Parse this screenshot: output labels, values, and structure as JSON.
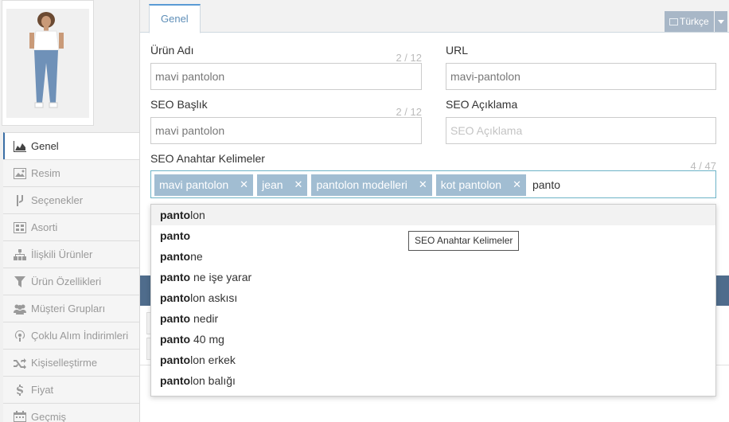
{
  "sidebar": {
    "items": [
      {
        "label": "Genel",
        "icon": "area-chart-icon",
        "active": true
      },
      {
        "label": "Resim",
        "icon": "image-icon",
        "active": false
      },
      {
        "label": "Seçenekler",
        "icon": "branch-icon",
        "active": false
      },
      {
        "label": "Asorti",
        "icon": "grid-icon",
        "active": false
      },
      {
        "label": "İlişkili Ürünler",
        "icon": "sitemap-icon",
        "active": false
      },
      {
        "label": "Ürün Özellikleri",
        "icon": "filter-icon",
        "active": false
      },
      {
        "label": "Müşteri Grupları",
        "icon": "users-icon",
        "active": false
      },
      {
        "label": "Çoklu Alım İndirimleri",
        "icon": "podcast-icon",
        "active": false
      },
      {
        "label": "Kişiselleştirme",
        "icon": "shuffle-icon",
        "active": false
      },
      {
        "label": "Fiyat",
        "icon": "dollar-icon",
        "active": false
      },
      {
        "label": "Geçmiş",
        "icon": "calendar-icon",
        "active": false
      }
    ]
  },
  "tabs": [
    {
      "label": "Genel"
    }
  ],
  "language": {
    "label": "Türkçe"
  },
  "form": {
    "product_name": {
      "label": "Ürün Adı",
      "counter": "2 / 12",
      "value": "mavi pantolon"
    },
    "url": {
      "label": "URL",
      "value": "mavi-pantolon"
    },
    "seo_title": {
      "label": "SEO Başlık",
      "counter": "2 / 12",
      "value": "mavi pantolon"
    },
    "seo_description": {
      "label": "SEO Açıklama",
      "placeholder": "SEO Açıklama",
      "value": ""
    },
    "seo_keywords": {
      "label": "SEO Anahtar Kelimeler",
      "counter": "4 / 47",
      "tags": [
        "mavi pantolon",
        "jean",
        "pantolon modelleri",
        "kot pantolon"
      ],
      "input_value": "panto"
    }
  },
  "autocomplete": {
    "suggestions": [
      {
        "bold": "panto",
        "rest": "lon",
        "highlighted": true
      },
      {
        "bold": "panto",
        "rest": "",
        "highlighted": false
      },
      {
        "bold": "panto",
        "rest": "ne",
        "highlighted": false
      },
      {
        "bold": "panto",
        "rest": " ne işe yarar",
        "highlighted": false
      },
      {
        "bold": "panto",
        "rest": "lon askısı",
        "highlighted": false
      },
      {
        "bold": "panto",
        "rest": " nedir",
        "highlighted": false
      },
      {
        "bold": "panto",
        "rest": " 40 mg",
        "highlighted": false
      },
      {
        "bold": "panto",
        "rest": "lon erkek",
        "highlighted": false
      },
      {
        "bold": "panto",
        "rest": "lon balığı",
        "highlighted": false
      }
    ]
  },
  "tooltip": {
    "text": "SEO Anahtar Kelimeler"
  },
  "colors": {
    "accent": "#5a9bd5",
    "tag_bg": "#a1bdd2",
    "lang_btn": "#a8b7c7",
    "tagbox_border": "#6db3c7"
  }
}
